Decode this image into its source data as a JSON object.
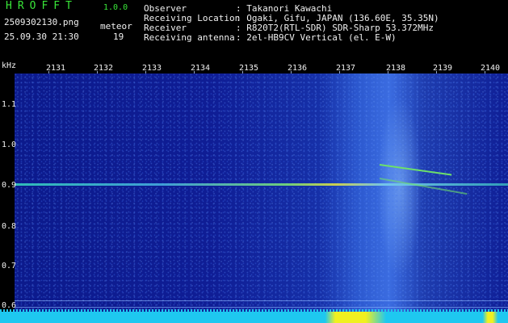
{
  "header": {
    "app_title": "HROFFT",
    "version": "1.0.0",
    "filename": "2509302130.png",
    "datetime": "25.09.30 21:30",
    "meteor_label": "meteor",
    "meteor_count": "19",
    "info": [
      {
        "label": "Observer",
        "value": ": Takanori Kawachi"
      },
      {
        "label": "Receiving Location",
        "value": ": Ogaki, Gifu, JAPAN (136.60E, 35.35N)"
      },
      {
        "label": "Receiver",
        "value": ": R820T2(RTL-SDR) SDR-Sharp 53.372MHz"
      },
      {
        "label": "Receiving antenna",
        "value": ": 2el-HB9CV Vertical (el. E-W)"
      }
    ]
  },
  "axes": {
    "y_unit": "kHz",
    "y_ticks": [
      "1.1",
      "1.0",
      "0.9",
      "0.8",
      "0.7",
      "0.6"
    ],
    "x_ticks": [
      "2131",
      "2132",
      "2133",
      "2134",
      "2135",
      "2136",
      "2137",
      "2138",
      "2139",
      "2140"
    ]
  },
  "colors": {
    "header_green": "#39e639",
    "background": "#000000",
    "waterfall_blue": "#0f1d95",
    "floor_cyan": "#1ec8f0",
    "floor_yellow": "#f0f020"
  }
}
